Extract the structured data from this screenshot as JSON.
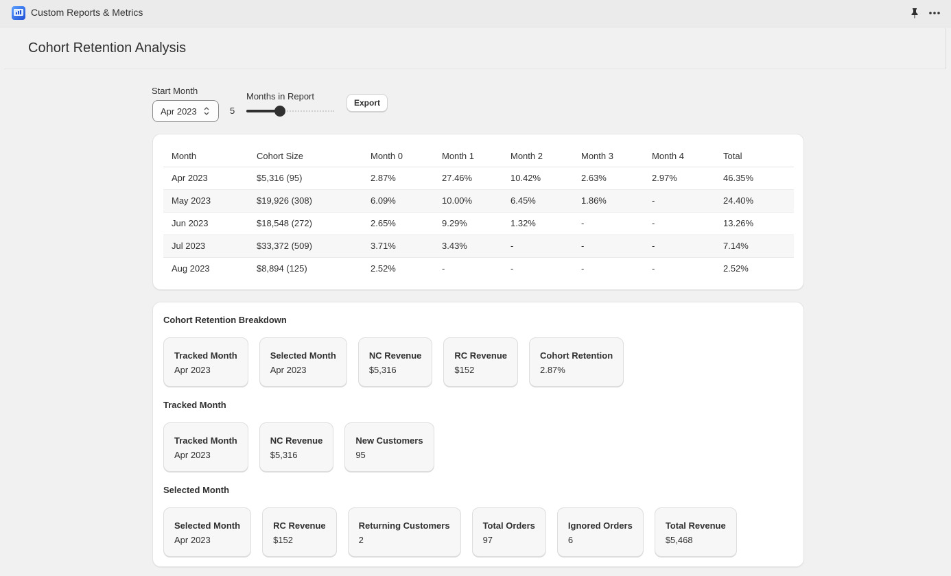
{
  "app": {
    "title": "Custom Reports & Metrics",
    "icons": {
      "app": "app-logo-icon",
      "pin": "pin-icon",
      "more": "more-icon"
    }
  },
  "page": {
    "title": "Cohort Retention Analysis"
  },
  "controls": {
    "start_month_label": "Start Month",
    "start_month_value": "Apr 2023",
    "months_label": "Months in Report",
    "months_value": "5",
    "months_fraction": 0.38,
    "export_label": "Export"
  },
  "table": {
    "headers": [
      "Month",
      "Cohort Size",
      "Month 0",
      "Month 1",
      "Month 2",
      "Month 3",
      "Month 4",
      "Total"
    ],
    "rows": [
      [
        "Apr 2023",
        "$5,316 (95)",
        "2.87%",
        "27.46%",
        "10.42%",
        "2.63%",
        "2.97%",
        "46.35%"
      ],
      [
        "May 2023",
        "$19,926 (308)",
        "6.09%",
        "10.00%",
        "6.45%",
        "1.86%",
        "-",
        "24.40%"
      ],
      [
        "Jun 2023",
        "$18,548 (272)",
        "2.65%",
        "9.29%",
        "1.32%",
        "-",
        "-",
        "13.26%"
      ],
      [
        "Jul 2023",
        "$33,372 (509)",
        "3.71%",
        "3.43%",
        "-",
        "-",
        "-",
        "7.14%"
      ],
      [
        "Aug 2023",
        "$8,894 (125)",
        "2.52%",
        "-",
        "-",
        "-",
        "-",
        "2.52%"
      ]
    ]
  },
  "breakdown": {
    "title": "Cohort Retention Breakdown",
    "tiles": [
      {
        "label": "Tracked Month",
        "value": "Apr 2023"
      },
      {
        "label": "Selected Month",
        "value": "Apr 2023"
      },
      {
        "label": "NC Revenue",
        "value": "$5,316"
      },
      {
        "label": "RC Revenue",
        "value": "$152"
      },
      {
        "label": "Cohort Retention",
        "value": "2.87%"
      }
    ]
  },
  "tracked": {
    "title": "Tracked Month",
    "tiles": [
      {
        "label": "Tracked Month",
        "value": "Apr 2023"
      },
      {
        "label": "NC Revenue",
        "value": "$5,316"
      },
      {
        "label": "New Customers",
        "value": "95"
      }
    ]
  },
  "selected": {
    "title": "Selected Month",
    "tiles": [
      {
        "label": "Selected Month",
        "value": "Apr 2023"
      },
      {
        "label": "RC Revenue",
        "value": "$152"
      },
      {
        "label": "Returning Customers",
        "value": "2"
      },
      {
        "label": "Total Orders",
        "value": "97"
      },
      {
        "label": "Ignored Orders",
        "value": "6"
      },
      {
        "label": "Total Revenue",
        "value": "$5,468"
      }
    ]
  }
}
